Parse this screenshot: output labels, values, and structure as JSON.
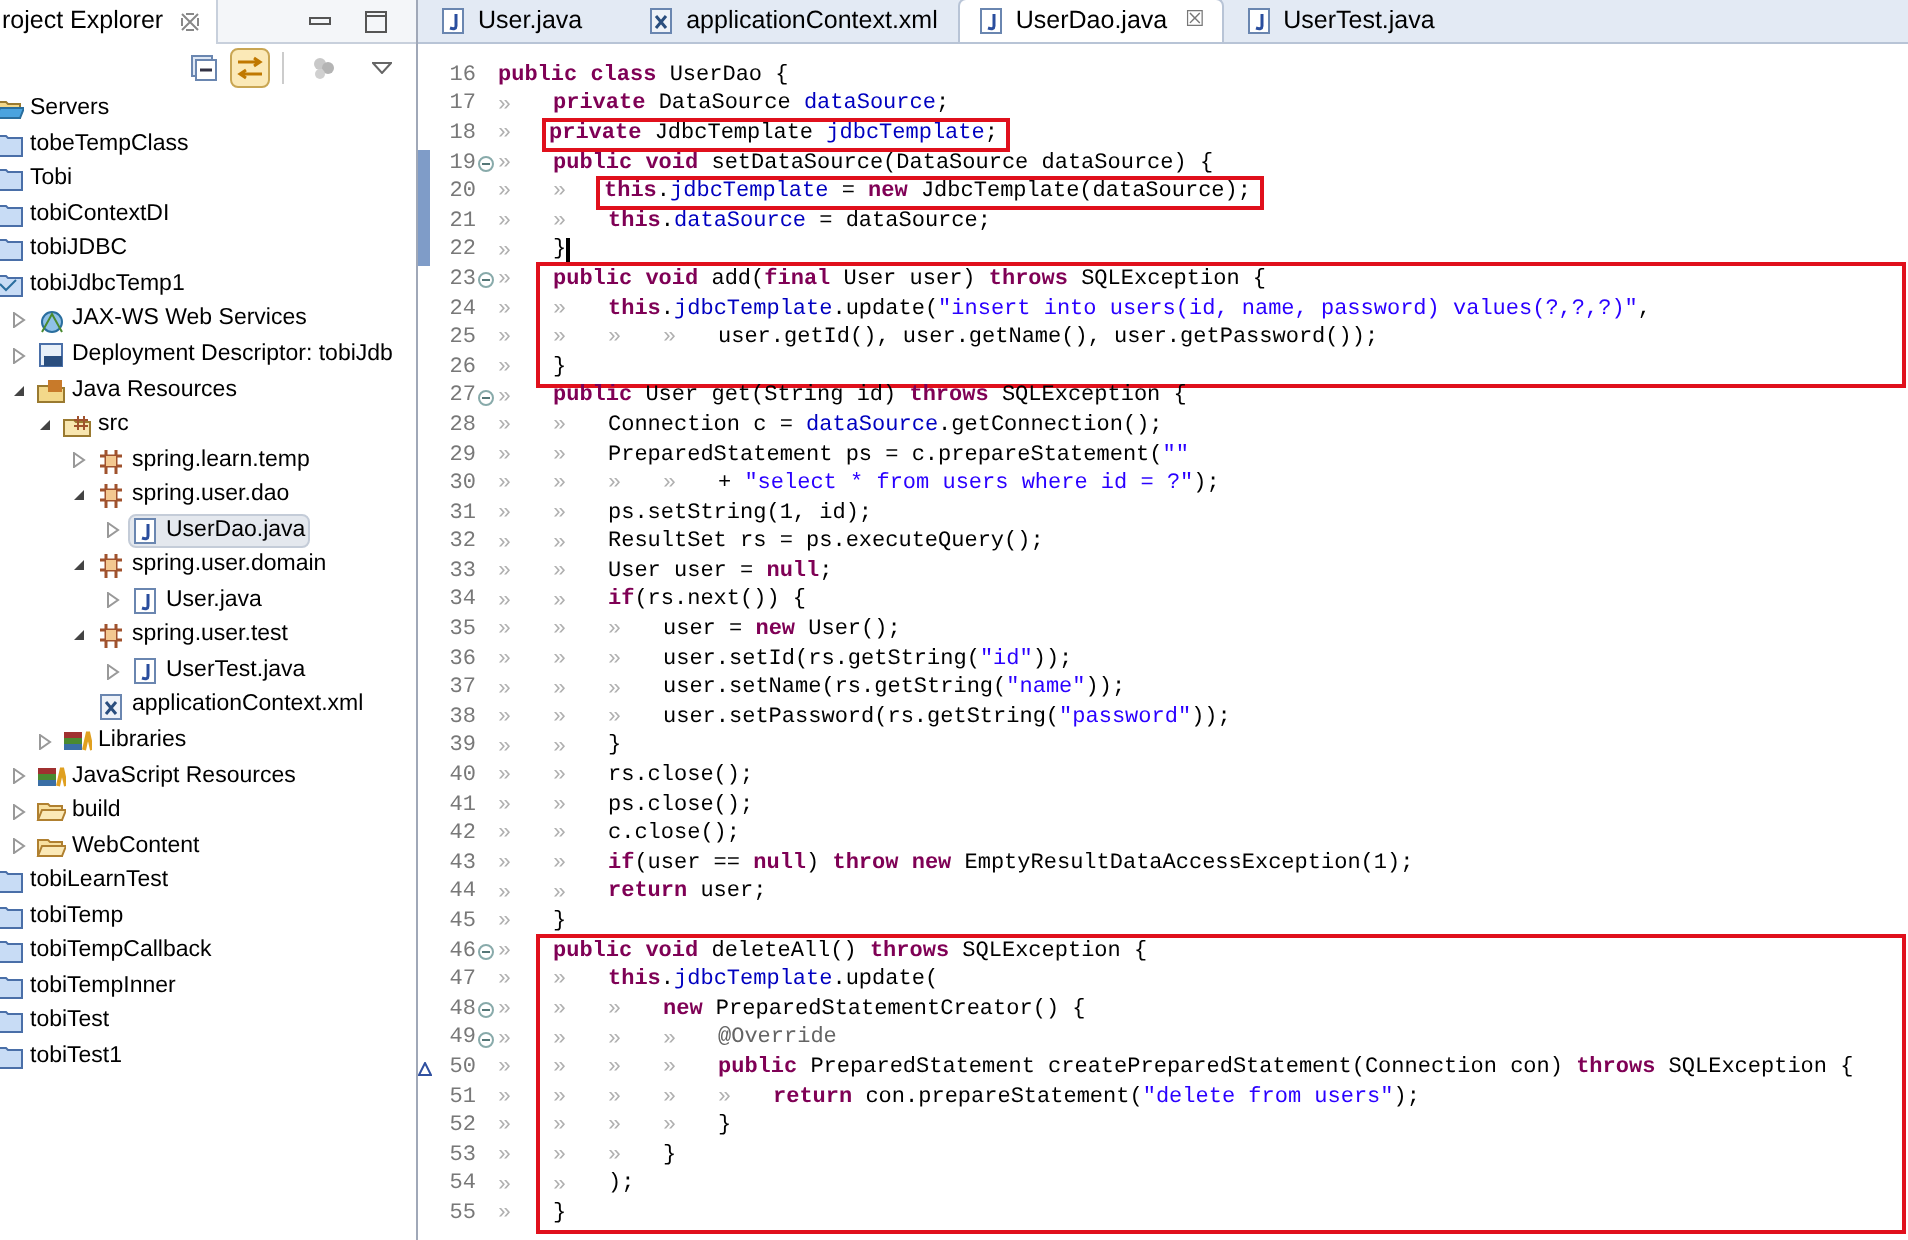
{
  "explorer": {
    "title": "roject Explorer",
    "tree": [
      {
        "kind": "servers",
        "label": "Servers",
        "selected": false
      },
      {
        "kind": "project",
        "label": "tobeTempClass",
        "selected": false
      },
      {
        "kind": "project",
        "label": "Tobi",
        "selected": false
      },
      {
        "kind": "project",
        "label": "tobiContextDI",
        "selected": false
      },
      {
        "kind": "project",
        "label": "tobiJDBC",
        "selected": false
      },
      {
        "kind": "webproject",
        "label": "tobiJdbcTemp1",
        "selected": false,
        "children": [
          {
            "kind": "webservices",
            "label": "JAX-WS Web Services",
            "expanded": false,
            "selected": false
          },
          {
            "kind": "deployment",
            "label": "Deployment Descriptor: tobiJdb",
            "expanded": false,
            "selected": false
          },
          {
            "kind": "javares",
            "label": "Java Resources",
            "expanded": true,
            "selected": false,
            "children": [
              {
                "kind": "src",
                "label": "src",
                "expanded": true,
                "selected": false,
                "children": [
                  {
                    "kind": "package",
                    "label": "spring.learn.temp",
                    "expanded": false,
                    "selected": false
                  },
                  {
                    "kind": "package",
                    "label": "spring.user.dao",
                    "expanded": true,
                    "selected": false,
                    "children": [
                      {
                        "kind": "java",
                        "label": "UserDao.java",
                        "expanded": false,
                        "selected": true
                      }
                    ]
                  },
                  {
                    "kind": "package",
                    "label": "spring.user.domain",
                    "expanded": true,
                    "selected": false,
                    "children": [
                      {
                        "kind": "java",
                        "label": "User.java",
                        "expanded": false,
                        "selected": false
                      }
                    ]
                  },
                  {
                    "kind": "package",
                    "label": "spring.user.test",
                    "expanded": true,
                    "selected": false,
                    "children": [
                      {
                        "kind": "java",
                        "label": "UserTest.java",
                        "expanded": false,
                        "selected": false
                      }
                    ]
                  },
                  {
                    "kind": "xml",
                    "label": "applicationContext.xml",
                    "selected": false
                  }
                ]
              },
              {
                "kind": "libraries",
                "label": "Libraries",
                "expanded": false,
                "selected": false
              }
            ]
          },
          {
            "kind": "libraries",
            "label": "JavaScript Resources",
            "expanded": false,
            "selected": false
          },
          {
            "kind": "folder",
            "label": "build",
            "expanded": false,
            "selected": false
          },
          {
            "kind": "folder",
            "label": "WebContent",
            "expanded": false,
            "selected": false
          }
        ]
      },
      {
        "kind": "project",
        "label": "tobiLearnTest",
        "selected": false
      },
      {
        "kind": "project",
        "label": "tobiTemp",
        "selected": false
      },
      {
        "kind": "project",
        "label": "tobiTempCallback",
        "selected": false
      },
      {
        "kind": "project",
        "label": "tobiTempInner",
        "selected": false
      },
      {
        "kind": "project",
        "label": "tobiTest",
        "selected": false
      },
      {
        "kind": "project",
        "label": "tobiTest1",
        "selected": false
      }
    ]
  },
  "editor": {
    "tabs": [
      {
        "kind": "java",
        "label": "User.java",
        "selected": false
      },
      {
        "kind": "xml",
        "label": "applicationContext.xml",
        "selected": false
      },
      {
        "kind": "java",
        "label": "UserDao.java",
        "selected": true,
        "close": "☒"
      },
      {
        "kind": "java",
        "label": "UserTest.java",
        "selected": false
      }
    ],
    "blocks": [
      {
        "boxed": false,
        "lines": [
          {
            "number": "16",
            "tokens": [
              {
                "kind": "keyword",
                "text": "public class"
              },
              {
                "kind": "plain",
                "text": " UserDao {"
              }
            ]
          },
          {
            "number": "17",
            "tokens": [
              {
                "kind": "tab",
                "text": "»"
              },
              {
                "kind": "keyword",
                "text": "private"
              },
              {
                "kind": "plain",
                "text": " DataSource "
              },
              {
                "kind": "field",
                "text": "dataSource"
              },
              {
                "kind": "plain",
                "text": ";"
              }
            ]
          },
          {
            "number": "18",
            "boxed": true,
            "tokens": [
              {
                "kind": "tab",
                "text": "»"
              },
              {
                "kind": "keyword",
                "text": "private"
              },
              {
                "kind": "plain",
                "text": " JdbcTemplate "
              },
              {
                "kind": "field",
                "text": "jdbcTemplate"
              },
              {
                "kind": "plain",
                "text": ";"
              }
            ]
          },
          {
            "number": "19",
            "foldable": true,
            "changed": true,
            "tokens": [
              {
                "kind": "tab",
                "text": "»"
              },
              {
                "kind": "keyword",
                "text": "public void"
              },
              {
                "kind": "plain",
                "text": " setDataSource(DataSource dataSource) {"
              }
            ]
          },
          {
            "number": "20",
            "changed": true,
            "boxed": true,
            "tokens": [
              {
                "kind": "tab",
                "text": "»"
              },
              {
                "kind": "tab",
                "text": "»"
              },
              {
                "kind": "keyword",
                "text": "this"
              },
              {
                "kind": "plain",
                "text": "."
              },
              {
                "kind": "field",
                "text": "jdbcTemplate"
              },
              {
                "kind": "plain",
                "text": " = "
              },
              {
                "kind": "keyword",
                "text": "new"
              },
              {
                "kind": "plain",
                "text": " JdbcTemplate(dataSource);"
              }
            ]
          },
          {
            "number": "21",
            "changed": true,
            "tokens": [
              {
                "kind": "tab",
                "text": "»"
              },
              {
                "kind": "tab",
                "text": "»"
              },
              {
                "kind": "keyword",
                "text": "this"
              },
              {
                "kind": "plain",
                "text": "."
              },
              {
                "kind": "field",
                "text": "dataSource"
              },
              {
                "kind": "plain",
                "text": " = dataSource;"
              }
            ]
          },
          {
            "number": "22",
            "changed": true,
            "cursor": true,
            "tokens": [
              {
                "kind": "tab",
                "text": "»"
              },
              {
                "kind": "plain",
                "text": "}"
              }
            ]
          }
        ]
      },
      {
        "boxed": true,
        "lines": [
          {
            "number": "23",
            "foldable": true,
            "tokens": [
              {
                "kind": "tab",
                "text": "»"
              },
              {
                "kind": "keyword",
                "text": "public void"
              },
              {
                "kind": "plain",
                "text": " add("
              },
              {
                "kind": "keyword",
                "text": "final"
              },
              {
                "kind": "plain",
                "text": " User user) "
              },
              {
                "kind": "keyword",
                "text": "throws"
              },
              {
                "kind": "plain",
                "text": " SQLException {"
              }
            ]
          },
          {
            "number": "24",
            "tokens": [
              {
                "kind": "tab",
                "text": "»"
              },
              {
                "kind": "tab",
                "text": "»"
              },
              {
                "kind": "keyword",
                "text": "this"
              },
              {
                "kind": "plain",
                "text": "."
              },
              {
                "kind": "field",
                "text": "jdbcTemplate"
              },
              {
                "kind": "plain",
                "text": ".update("
              },
              {
                "kind": "string",
                "text": "\"insert into users(id, name, password) values(?,?,?)\""
              },
              {
                "kind": "plain",
                "text": ","
              }
            ]
          },
          {
            "number": "25",
            "tokens": [
              {
                "kind": "tab",
                "text": "»"
              },
              {
                "kind": "tab",
                "text": "»"
              },
              {
                "kind": "tab",
                "text": "»"
              },
              {
                "kind": "tab",
                "text": "»"
              },
              {
                "kind": "plain",
                "text": "user.getId(), user.getName(), user.getPassword());"
              }
            ]
          },
          {
            "number": "26",
            "tokens": [
              {
                "kind": "tab",
                "text": "»"
              },
              {
                "kind": "plain",
                "text": "}"
              }
            ]
          }
        ]
      },
      {
        "boxed": false,
        "lines": [
          {
            "number": "27",
            "foldable": true,
            "tokens": [
              {
                "kind": "tab",
                "text": "»"
              },
              {
                "kind": "keyword",
                "text": "public"
              },
              {
                "kind": "plain",
                "text": " User get(String id) "
              },
              {
                "kind": "keyword",
                "text": "throws"
              },
              {
                "kind": "plain",
                "text": " SQLException {"
              }
            ]
          },
          {
            "number": "28",
            "tokens": [
              {
                "kind": "tab",
                "text": "»"
              },
              {
                "kind": "tab",
                "text": "»"
              },
              {
                "kind": "plain",
                "text": "Connection c = "
              },
              {
                "kind": "field",
                "text": "dataSource"
              },
              {
                "kind": "plain",
                "text": ".getConnection();"
              }
            ]
          },
          {
            "number": "29",
            "tokens": [
              {
                "kind": "tab",
                "text": "»"
              },
              {
                "kind": "tab",
                "text": "»"
              },
              {
                "kind": "plain",
                "text": "PreparedStatement ps = c.prepareStatement("
              },
              {
                "kind": "string",
                "text": "\"\""
              }
            ]
          },
          {
            "number": "30",
            "tokens": [
              {
                "kind": "tab",
                "text": "»"
              },
              {
                "kind": "tab",
                "text": "»"
              },
              {
                "kind": "tab",
                "text": "»"
              },
              {
                "kind": "tab",
                "text": "»"
              },
              {
                "kind": "plain",
                "text": "+ "
              },
              {
                "kind": "string",
                "text": "\"select * from users where id = ?\""
              },
              {
                "kind": "plain",
                "text": ");"
              }
            ]
          },
          {
            "number": "31",
            "tokens": [
              {
                "kind": "tab",
                "text": "»"
              },
              {
                "kind": "tab",
                "text": "»"
              },
              {
                "kind": "plain",
                "text": "ps.setString(1, id);"
              }
            ]
          },
          {
            "number": "32",
            "tokens": [
              {
                "kind": "tab",
                "text": "»"
              },
              {
                "kind": "tab",
                "text": "»"
              },
              {
                "kind": "plain",
                "text": "ResultSet rs = ps.executeQuery();"
              }
            ]
          },
          {
            "number": "33",
            "tokens": [
              {
                "kind": "tab",
                "text": "»"
              },
              {
                "kind": "tab",
                "text": "»"
              },
              {
                "kind": "plain",
                "text": "User user = "
              },
              {
                "kind": "keyword",
                "text": "null"
              },
              {
                "kind": "plain",
                "text": ";"
              }
            ]
          },
          {
            "number": "34",
            "tokens": [
              {
                "kind": "tab",
                "text": "»"
              },
              {
                "kind": "tab",
                "text": "»"
              },
              {
                "kind": "keyword",
                "text": "if"
              },
              {
                "kind": "plain",
                "text": "(rs.next()) {"
              }
            ]
          },
          {
            "number": "35",
            "tokens": [
              {
                "kind": "tab",
                "text": "»"
              },
              {
                "kind": "tab",
                "text": "»"
              },
              {
                "kind": "tab",
                "text": "»"
              },
              {
                "kind": "plain",
                "text": "user = "
              },
              {
                "kind": "keyword",
                "text": "new"
              },
              {
                "kind": "plain",
                "text": " User();"
              }
            ]
          },
          {
            "number": "36",
            "tokens": [
              {
                "kind": "tab",
                "text": "»"
              },
              {
                "kind": "tab",
                "text": "»"
              },
              {
                "kind": "tab",
                "text": "»"
              },
              {
                "kind": "plain",
                "text": "user.setId(rs.getString("
              },
              {
                "kind": "string",
                "text": "\"id\""
              },
              {
                "kind": "plain",
                "text": "));"
              }
            ]
          },
          {
            "number": "37",
            "tokens": [
              {
                "kind": "tab",
                "text": "»"
              },
              {
                "kind": "tab",
                "text": "»"
              },
              {
                "kind": "tab",
                "text": "»"
              },
              {
                "kind": "plain",
                "text": "user.setName(rs.getString("
              },
              {
                "kind": "string",
                "text": "\"name\""
              },
              {
                "kind": "plain",
                "text": "));"
              }
            ]
          },
          {
            "number": "38",
            "tokens": [
              {
                "kind": "tab",
                "text": "»"
              },
              {
                "kind": "tab",
                "text": "»"
              },
              {
                "kind": "tab",
                "text": "»"
              },
              {
                "kind": "plain",
                "text": "user.setPassword(rs.getString("
              },
              {
                "kind": "string",
                "text": "\"password\""
              },
              {
                "kind": "plain",
                "text": "));"
              }
            ]
          },
          {
            "number": "39",
            "tokens": [
              {
                "kind": "tab",
                "text": "»"
              },
              {
                "kind": "tab",
                "text": "»"
              },
              {
                "kind": "plain",
                "text": "}"
              }
            ]
          },
          {
            "number": "40",
            "tokens": [
              {
                "kind": "tab",
                "text": "»"
              },
              {
                "kind": "tab",
                "text": "»"
              },
              {
                "kind": "plain",
                "text": "rs.close();"
              }
            ]
          },
          {
            "number": "41",
            "tokens": [
              {
                "kind": "tab",
                "text": "»"
              },
              {
                "kind": "tab",
                "text": "»"
              },
              {
                "kind": "plain",
                "text": "ps.close();"
              }
            ]
          },
          {
            "number": "42",
            "tokens": [
              {
                "kind": "tab",
                "text": "»"
              },
              {
                "kind": "tab",
                "text": "»"
              },
              {
                "kind": "plain",
                "text": "c.close();"
              }
            ]
          },
          {
            "number": "43",
            "tokens": [
              {
                "kind": "tab",
                "text": "»"
              },
              {
                "kind": "tab",
                "text": "»"
              },
              {
                "kind": "keyword",
                "text": "if"
              },
              {
                "kind": "plain",
                "text": "(user == "
              },
              {
                "kind": "keyword",
                "text": "null"
              },
              {
                "kind": "plain",
                "text": ") "
              },
              {
                "kind": "keyword",
                "text": "throw new"
              },
              {
                "kind": "plain",
                "text": " EmptyResultDataAccessException(1);"
              }
            ]
          },
          {
            "number": "44",
            "tokens": [
              {
                "kind": "tab",
                "text": "»"
              },
              {
                "kind": "tab",
                "text": "»"
              },
              {
                "kind": "keyword",
                "text": "return"
              },
              {
                "kind": "plain",
                "text": " user;"
              }
            ]
          },
          {
            "number": "45",
            "tokens": [
              {
                "kind": "tab",
                "text": "»"
              },
              {
                "kind": "plain",
                "text": "}"
              }
            ]
          }
        ]
      },
      {
        "boxed": true,
        "lines": [
          {
            "number": "46",
            "foldable": true,
            "tokens": [
              {
                "kind": "tab",
                "text": "»"
              },
              {
                "kind": "keyword",
                "text": "public void"
              },
              {
                "kind": "plain",
                "text": " deleteAll() "
              },
              {
                "kind": "keyword",
                "text": "throws"
              },
              {
                "kind": "plain",
                "text": " SQLException {"
              }
            ]
          },
          {
            "number": "47",
            "tokens": [
              {
                "kind": "tab",
                "text": "»"
              },
              {
                "kind": "tab",
                "text": "»"
              },
              {
                "kind": "keyword",
                "text": "this"
              },
              {
                "kind": "plain",
                "text": "."
              },
              {
                "kind": "field",
                "text": "jdbcTemplate"
              },
              {
                "kind": "plain",
                "text": ".update("
              }
            ]
          },
          {
            "number": "48",
            "foldable": true,
            "tokens": [
              {
                "kind": "tab",
                "text": "»"
              },
              {
                "kind": "tab",
                "text": "»"
              },
              {
                "kind": "tab",
                "text": "»"
              },
              {
                "kind": "keyword",
                "text": "new"
              },
              {
                "kind": "plain",
                "text": " PreparedStatementCreator() {"
              }
            ]
          },
          {
            "number": "49",
            "foldable": true,
            "tokens": [
              {
                "kind": "tab",
                "text": "»"
              },
              {
                "kind": "tab",
                "text": "»"
              },
              {
                "kind": "tab",
                "text": "»"
              },
              {
                "kind": "tab",
                "text": "»"
              },
              {
                "kind": "annotation",
                "text": "@Override"
              }
            ]
          },
          {
            "number": "50",
            "override": true,
            "tokens": [
              {
                "kind": "tab",
                "text": "»"
              },
              {
                "kind": "tab",
                "text": "»"
              },
              {
                "kind": "tab",
                "text": "»"
              },
              {
                "kind": "tab",
                "text": "»"
              },
              {
                "kind": "keyword",
                "text": "public"
              },
              {
                "kind": "plain",
                "text": " PreparedStatement createPreparedStatement(Connection con) "
              },
              {
                "kind": "keyword",
                "text": "throws"
              },
              {
                "kind": "plain",
                "text": " SQLException {"
              }
            ]
          },
          {
            "number": "51",
            "tokens": [
              {
                "kind": "tab",
                "text": "»"
              },
              {
                "kind": "tab",
                "text": "»"
              },
              {
                "kind": "tab",
                "text": "»"
              },
              {
                "kind": "tab",
                "text": "»"
              },
              {
                "kind": "tab",
                "text": "»"
              },
              {
                "kind": "keyword",
                "text": "return"
              },
              {
                "kind": "plain",
                "text": " con.prepareStatement("
              },
              {
                "kind": "string",
                "text": "\"delete from users\""
              },
              {
                "kind": "plain",
                "text": ");"
              }
            ]
          },
          {
            "number": "52",
            "tokens": [
              {
                "kind": "tab",
                "text": "»"
              },
              {
                "kind": "tab",
                "text": "»"
              },
              {
                "kind": "tab",
                "text": "»"
              },
              {
                "kind": "tab",
                "text": "»"
              },
              {
                "kind": "plain",
                "text": "}"
              }
            ]
          },
          {
            "number": "53",
            "tokens": [
              {
                "kind": "tab",
                "text": "»"
              },
              {
                "kind": "tab",
                "text": "»"
              },
              {
                "kind": "tab",
                "text": "»"
              },
              {
                "kind": "plain",
                "text": "}"
              }
            ]
          },
          {
            "number": "54",
            "tokens": [
              {
                "kind": "tab",
                "text": "»"
              },
              {
                "kind": "tab",
                "text": "»"
              },
              {
                "kind": "plain",
                "text": ");"
              }
            ]
          },
          {
            "number": "55",
            "tokens": [
              {
                "kind": "tab",
                "text": "»"
              },
              {
                "kind": "plain",
                "text": "}"
              }
            ]
          }
        ]
      }
    ]
  }
}
